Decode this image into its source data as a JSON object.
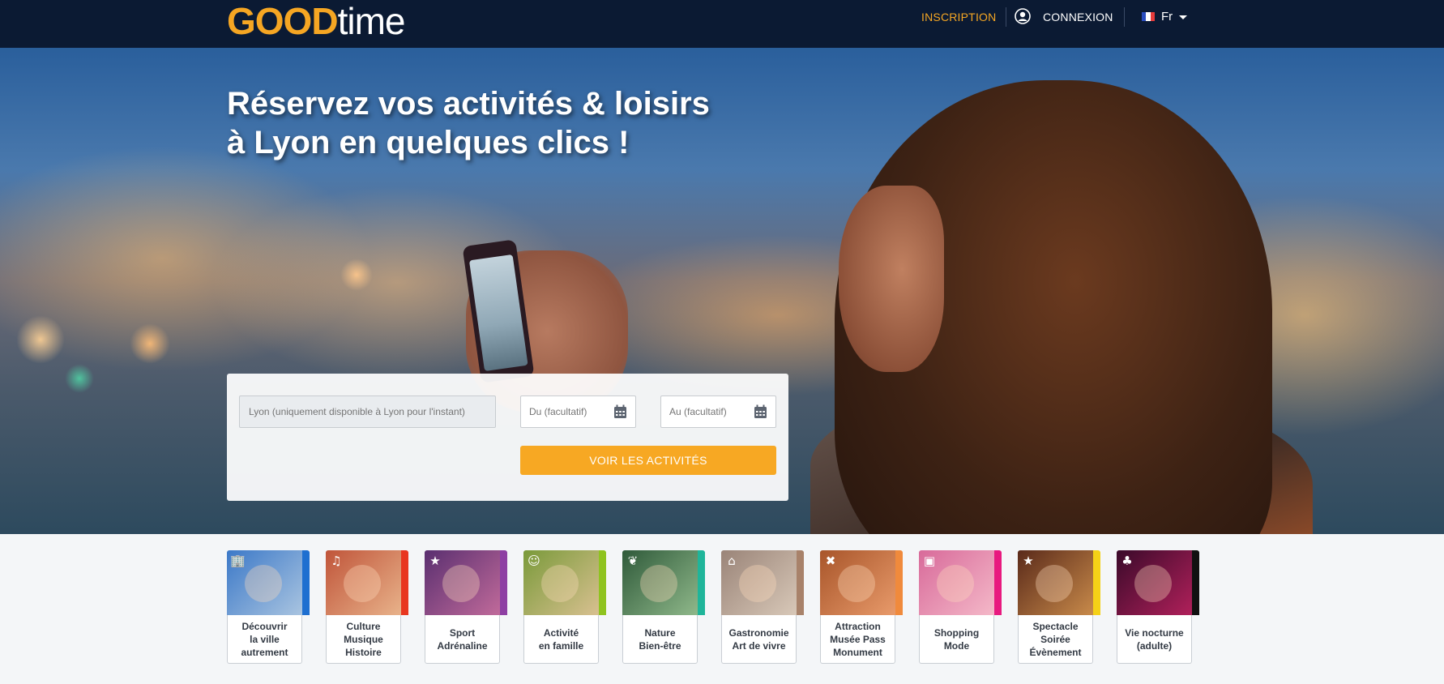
{
  "header": {
    "logo_good": "GOOD",
    "logo_time": "time",
    "inscription": "INSCRIPTION",
    "connexion": "CONNEXION",
    "language": "Fr",
    "user_icon": "user-circle-icon",
    "flag_icon": "france-flag-icon"
  },
  "hero": {
    "title": "Réservez vos activités & loisirs\nà Lyon en quelques clics !"
  },
  "search": {
    "city_placeholder": "Lyon (uniquement disponible à Lyon pour l'instant)",
    "from_placeholder": "Du (facultatif)",
    "to_placeholder": "Au (facultatif)",
    "calendar_icon": "calendar-icon",
    "submit_label": "VOIR LES ACTIVITÉS"
  },
  "categories": [
    {
      "label": "Découvrir\nla ville\nautrement",
      "icon": "city-icon",
      "accent": "#1e6fd0"
    },
    {
      "label": "Culture\nMusique\nHistoire",
      "icon": "music-note-icon",
      "accent": "#e8361f"
    },
    {
      "label": "Sport\nAdrénaline",
      "icon": "runner-icon",
      "accent": "#8e3fa3"
    },
    {
      "label": "Activité\nen famille",
      "icon": "family-icon",
      "accent": "#8fc31f"
    },
    {
      "label": "Nature\nBien-être",
      "icon": "leaf-icon",
      "accent": "#1fb59a"
    },
    {
      "label": "Gastronomie\nArt de vivre",
      "icon": "cloche-icon",
      "accent": "#a8826a"
    },
    {
      "label": "Attraction\nMusée Pass\nMonument",
      "icon": "ticket-icon",
      "accent": "#f08a3c"
    },
    {
      "label": "Shopping\nMode",
      "icon": "shopping-bag-icon",
      "accent": "#e8197f"
    },
    {
      "label": "Spectacle\nSoirée\nÉvènement",
      "icon": "star-stage-icon",
      "accent": "#f5d117"
    },
    {
      "label": "Vie nocturne\n(adulte)",
      "icon": "cocktail-icon",
      "accent": "#111111"
    }
  ]
}
